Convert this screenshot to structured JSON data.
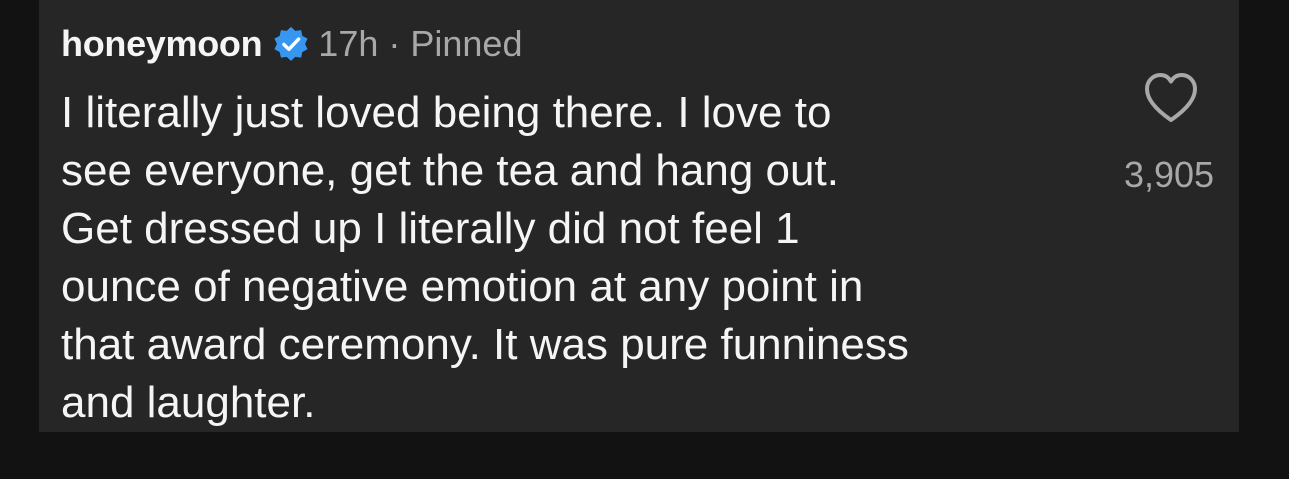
{
  "comment": {
    "username": "honeymoon",
    "time_ago": "17h",
    "separator": "·",
    "pinned_label": "Pinned",
    "text_lines": [
      "I literally just loved being there. I love to",
      "see everyone, get the tea and hang out.",
      "Get dressed up I literally did not feel 1",
      "ounce of negative emotion at any point in",
      "that award ceremony. It was pure funniness",
      "and laughter."
    ],
    "like_count": "3,905"
  },
  "icons": {
    "verified": "verified-badge-icon",
    "like": "heart-outline-icon"
  },
  "colors": {
    "background": "#121212",
    "card": "#262626",
    "primary_text": "#f5f5f5",
    "secondary_text": "#a8a8a8",
    "verified_blue": "#3797f0"
  }
}
